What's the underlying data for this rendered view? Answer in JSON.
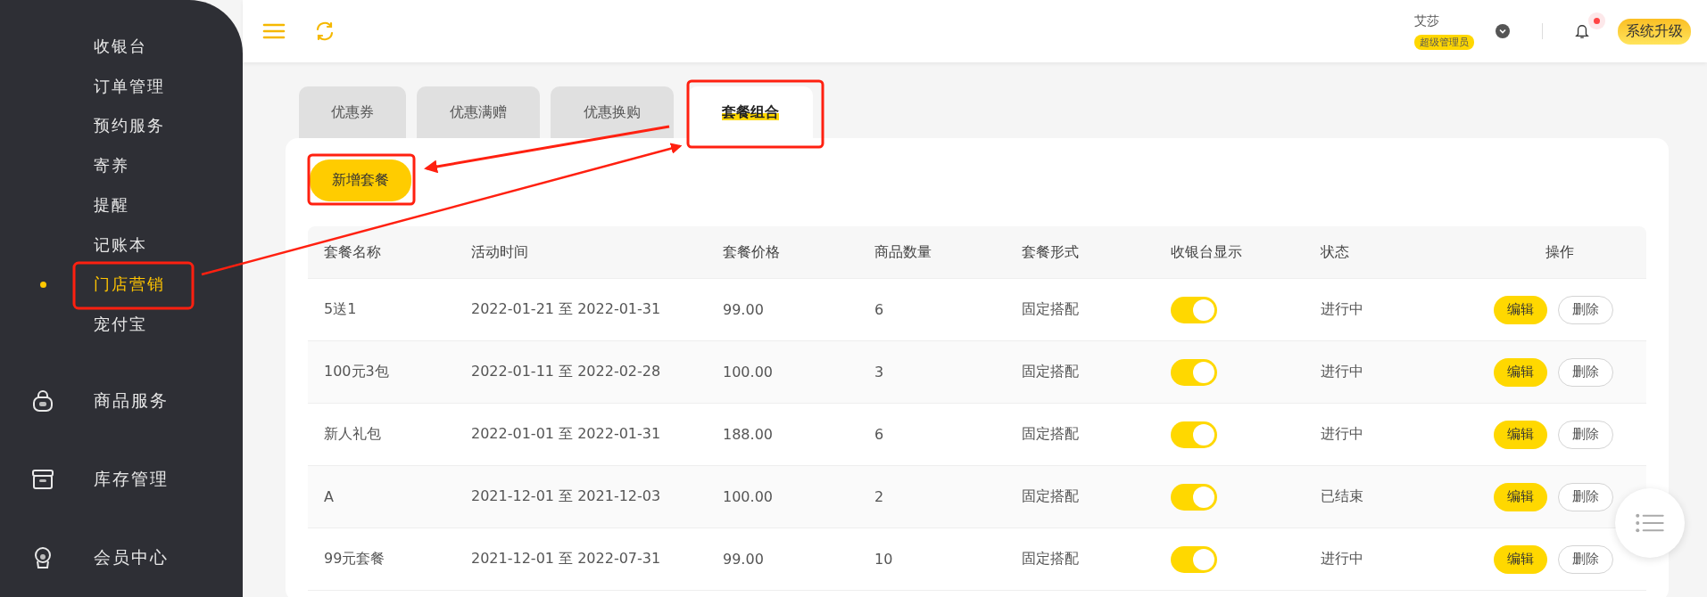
{
  "sidebar": {
    "items": [
      {
        "label": "收银台",
        "kind": "sub",
        "selected": false
      },
      {
        "label": "订单管理",
        "kind": "sub",
        "selected": false
      },
      {
        "label": "预约服务",
        "kind": "sub",
        "selected": false
      },
      {
        "label": "寄养",
        "kind": "sub",
        "selected": false
      },
      {
        "label": "提醒",
        "kind": "sub",
        "selected": false
      },
      {
        "label": "记账本",
        "kind": "sub",
        "selected": false
      },
      {
        "label": "门店营销",
        "kind": "sub",
        "selected": true
      },
      {
        "label": "宠付宝",
        "kind": "sub",
        "selected": false
      },
      {
        "label": "商品服务",
        "kind": "bag",
        "selected": false
      },
      {
        "label": "库存管理",
        "kind": "box",
        "selected": false
      },
      {
        "label": "会员中心",
        "kind": "person",
        "selected": false
      }
    ]
  },
  "header": {
    "user_name": "艾莎",
    "role": "超级管理员",
    "has_unread": true,
    "upgrade_button": "系统升级"
  },
  "tabs": [
    {
      "label": "优惠券",
      "selected": false
    },
    {
      "label": "优惠满赠",
      "selected": false
    },
    {
      "label": "优惠换购",
      "selected": false
    },
    {
      "label": "套餐组合",
      "selected": true
    }
  ],
  "add_button": "新增套餐",
  "table": {
    "columns": [
      "套餐名称",
      "活动时间",
      "套餐价格",
      "商品数量",
      "套餐形式",
      "收银台显示",
      "状态",
      "操作"
    ],
    "rows": [
      {
        "name": "5送1",
        "period": "2022-01-21 至 2022-01-31",
        "price": "99.00",
        "count": "6",
        "form": "固定搭配",
        "cashier_display": true,
        "status": "进行中",
        "edit": "编辑",
        "delete": "删除"
      },
      {
        "name": "100元3包",
        "period": "2022-01-11 至 2022-02-28",
        "price": "100.00",
        "count": "3",
        "form": "固定搭配",
        "cashier_display": true,
        "status": "进行中",
        "edit": "编辑",
        "delete": "删除"
      },
      {
        "name": "新人礼包",
        "period": "2022-01-01 至 2022-01-31",
        "price": "188.00",
        "count": "6",
        "form": "固定搭配",
        "cashier_display": true,
        "status": "进行中",
        "edit": "编辑",
        "delete": "删除"
      },
      {
        "name": "A",
        "period": "2021-12-01 至 2021-12-03",
        "price": "100.00",
        "count": "2",
        "form": "固定搭配",
        "cashier_display": true,
        "status": "已结束",
        "edit": "编辑",
        "delete": "删除"
      },
      {
        "name": "99元套餐",
        "period": "2021-12-01 至 2022-07-31",
        "price": "99.00",
        "count": "10",
        "form": "固定搭配",
        "cashier_display": true,
        "status": "进行中",
        "edit": "编辑",
        "delete": "删除"
      }
    ]
  }
}
